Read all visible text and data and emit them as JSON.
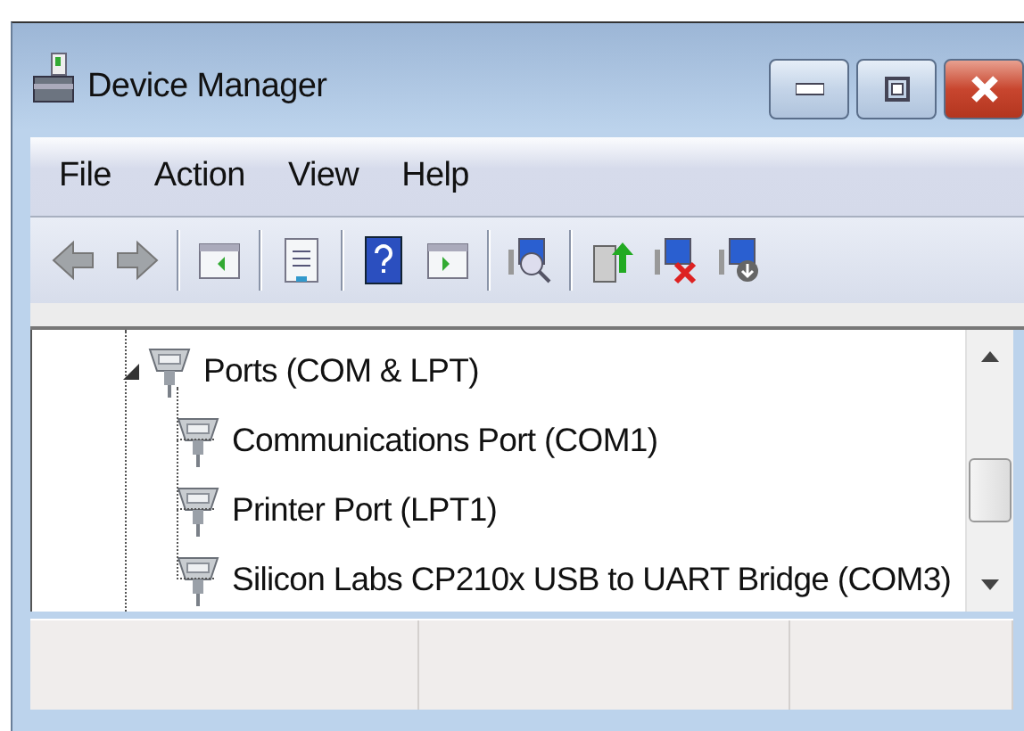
{
  "window": {
    "title": "Device Manager"
  },
  "menu": [
    {
      "label": "File"
    },
    {
      "label": "Action"
    },
    {
      "label": "View"
    },
    {
      "label": "Help"
    }
  ],
  "toolbar": [
    {
      "kind": "back",
      "disabled": true
    },
    {
      "kind": "forward",
      "disabled": true
    },
    {
      "kind": "sep"
    },
    {
      "kind": "pane"
    },
    {
      "kind": "sep"
    },
    {
      "kind": "properties"
    },
    {
      "kind": "sep"
    },
    {
      "kind": "help"
    },
    {
      "kind": "pane2"
    },
    {
      "kind": "sep"
    },
    {
      "kind": "scan"
    },
    {
      "kind": "sep"
    },
    {
      "kind": "update"
    },
    {
      "kind": "uninstall"
    },
    {
      "kind": "disable"
    }
  ],
  "tree": [
    {
      "label": "Ports (COM & LPT)",
      "expanded": true,
      "children": [
        {
          "label": "Communications Port (COM1)"
        },
        {
          "label": "Printer Port (LPT1)"
        },
        {
          "label": "Silicon Labs CP210x USB to UART Bridge (COM3)"
        }
      ]
    }
  ]
}
